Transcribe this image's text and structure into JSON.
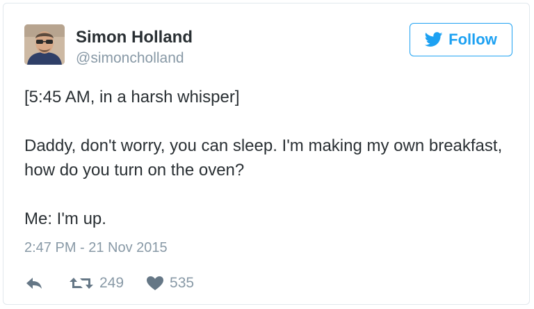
{
  "user": {
    "name": "Simon Holland",
    "handle": "@simoncholland"
  },
  "follow_button": {
    "label": "Follow",
    "icon": "twitter-bird-icon"
  },
  "tweet": {
    "line1": "[5:45 AM, in a harsh whisper]",
    "line2": "Daddy, don't worry, you can sleep. I'm making my own breakfast, how do you turn on the oven?",
    "line3": "Me: I'm up."
  },
  "timestamp": "2:47 PM - 21 Nov 2015",
  "actions": {
    "reply_icon": "reply-icon",
    "retweet_icon": "retweet-icon",
    "retweet_count": "249",
    "like_icon": "heart-icon",
    "like_count": "535"
  },
  "colors": {
    "accent": "#1da1f2",
    "text": "#292f33",
    "muted": "#8899a6",
    "border": "#e1e8ed"
  }
}
